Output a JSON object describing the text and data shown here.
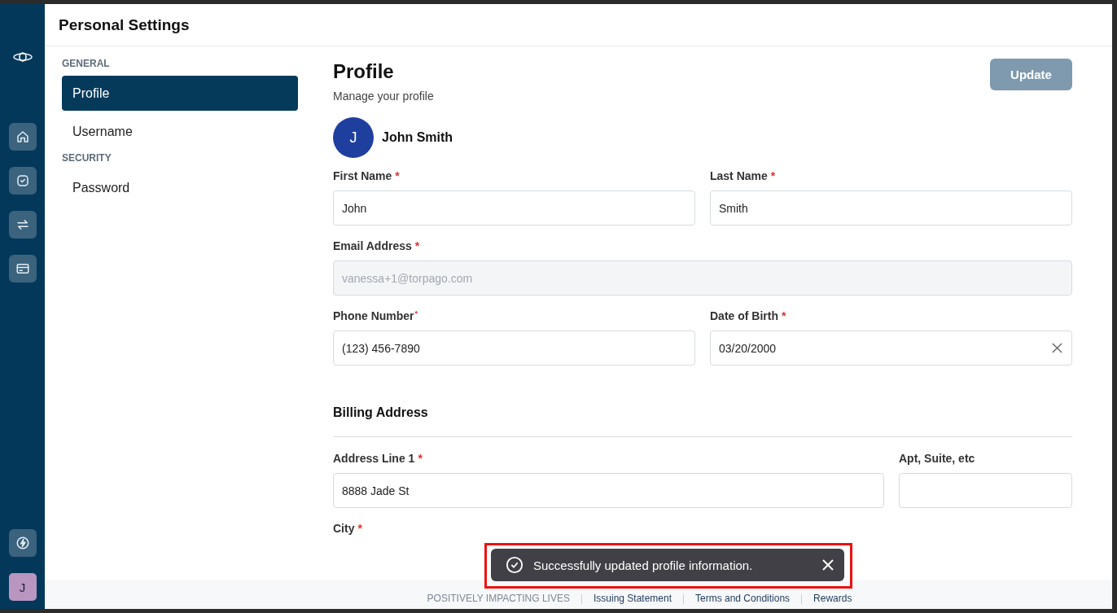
{
  "rail": {
    "avatar": "J"
  },
  "header": {
    "title": "Personal Settings"
  },
  "nav": [
    {
      "section": "GENERAL",
      "items": [
        {
          "label": "Profile",
          "selected": true
        },
        {
          "label": "Username",
          "selected": false
        }
      ]
    },
    {
      "section": "SECURITY",
      "items": [
        {
          "label": "Password",
          "selected": false
        }
      ]
    }
  ],
  "profile": {
    "title": "Profile",
    "subtitle": "Manage your profile",
    "update_button": {
      "label": "Update",
      "disabled": true
    },
    "avatar": "J",
    "name": "John Smith"
  },
  "rows": [
    {
      "kind": "pair",
      "fields": [
        {
          "label": "First Name",
          "mark": "*",
          "value": "John"
        },
        {
          "label": "Last Name",
          "mark": "*",
          "value": "Smith"
        }
      ]
    },
    {
      "kind": "single",
      "fields": [
        {
          "label": "Email Address",
          "mark": "*",
          "value": "vanessa+1@torpago.com",
          "disabled": true
        }
      ]
    },
    {
      "kind": "pair",
      "fields": [
        {
          "label": "Phone Number",
          "mark": "*",
          "raised": true,
          "value": "(123) 456-7890"
        },
        {
          "label": "Date of Birth",
          "mark": "*",
          "value": "03/20/2000",
          "clearable": true
        }
      ]
    }
  ],
  "billing": {
    "title": "Billing Address",
    "rows": [
      {
        "kind": "address",
        "fields": [
          {
            "label": "Address Line 1",
            "mark": "*",
            "value": "8888 Jade St"
          },
          {
            "label": "Apt, Suite, etc",
            "kind": "input"
          }
        ]
      },
      {
        "kind": "label_only",
        "fields": [
          {
            "label": "City",
            "mark": "*",
            "kind": "label"
          }
        ]
      }
    ]
  },
  "footer": {
    "links": [
      {
        "label": "POSITIVELY IMPACTING LIVES",
        "muted": true
      },
      {
        "label": "Issuing Statement"
      },
      {
        "label": "Terms and Conditions"
      },
      {
        "label": "Rewards"
      }
    ]
  },
  "toast": {
    "message": "Successfully updated profile information.",
    "highlighted": true
  }
}
